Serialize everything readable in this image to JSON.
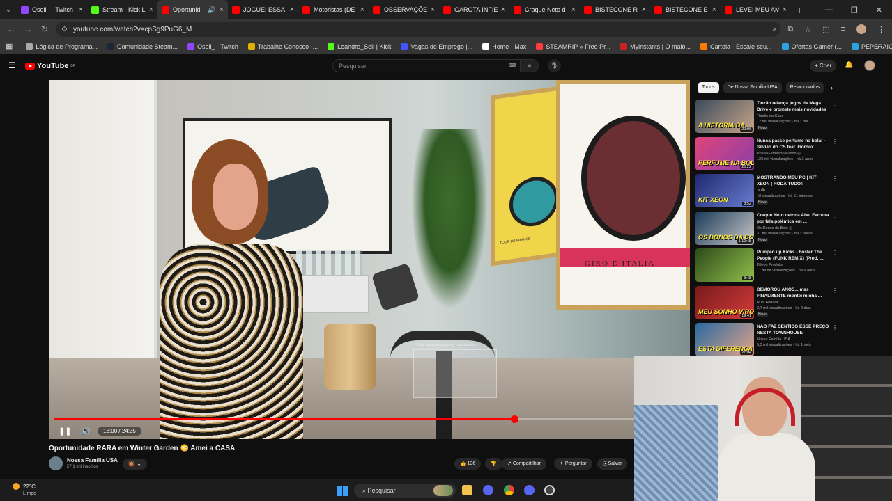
{
  "browser": {
    "tabs": [
      {
        "title": "Osell_ - Twitch",
        "color": "#9146ff",
        "active": false
      },
      {
        "title": "Stream - Kick L",
        "color": "#53fc18",
        "active": false
      },
      {
        "title": "Oportunid",
        "color": "#ff0000",
        "active": true
      },
      {
        "title": "JOGUEI ESSA P",
        "color": "#ff0000",
        "active": false
      },
      {
        "title": "Motoristas (DE",
        "color": "#ff0000",
        "active": false
      },
      {
        "title": "OBSERVAÇÕES",
        "color": "#ff0000",
        "active": false
      },
      {
        "title": "GAROTA INFIEL",
        "color": "#ff0000",
        "active": false
      },
      {
        "title": "Craque Neto d",
        "color": "#ff0000",
        "active": false
      },
      {
        "title": "BISTECONE RE",
        "color": "#ff0000",
        "active": false
      },
      {
        "title": "BISTECONE E C",
        "color": "#ff0000",
        "active": false
      },
      {
        "title": "LEVEI MEU AM",
        "color": "#ff0000",
        "active": false
      }
    ],
    "url": "youtube.com/watch?v=cpSg9PuG6_M",
    "bookmarks": [
      {
        "label": "Lógica de Programa...",
        "color": "#aaaaaa"
      },
      {
        "label": "Comunidade Steam...",
        "color": "#1b2838"
      },
      {
        "label": "Osell_ - Twitch",
        "color": "#9146ff"
      },
      {
        "label": "Trabalhe Conosco -...",
        "color": "#e0b000"
      },
      {
        "label": "Leandro_Sell | Kick",
        "color": "#53fc18"
      },
      {
        "label": "Vagas de Emprego |...",
        "color": "#4455ff"
      },
      {
        "label": "Home - Max",
        "color": "#ffffff"
      },
      {
        "label": "STEAMRIP » Free Pr...",
        "color": "#ff3b3b"
      },
      {
        "label": "Myinstants | O maio...",
        "color": "#cc2222"
      },
      {
        "label": "Cartola - Escale seu...",
        "color": "#ff7a00"
      },
      {
        "label": "Ofertas Gamer (...",
        "color": "#2aa3e0"
      },
      {
        "label": "PEPERAIO HARDWA...",
        "color": "#2aa3e0"
      }
    ]
  },
  "youtube": {
    "logo": "YouTube",
    "logo_region": "BR",
    "search_placeholder": "Pesquisar",
    "create_label": "Criar",
    "video": {
      "title": "Oportunidade RARA em Winter Garden 😳 Amei a CASA",
      "current_time": "18:00",
      "duration": "24:35",
      "time_display": "18:00 / 24:35",
      "progress_fraction": 0.73,
      "painting_label": "GIRO D'ITALIA",
      "poster_label": "TOUR DE FRANCE",
      "preview_text": "Puxe para cima para ver mais detalhes"
    },
    "channel": {
      "name": "Nossa Família USA",
      "subscribers": "57,1 mil inscritos"
    },
    "actions": {
      "likes": "136",
      "share": "Compartilhar",
      "ask": "Perguntar",
      "save": "Salvar"
    },
    "chips": [
      "Todos",
      "De Nossa Família USA",
      "Relacionados"
    ],
    "recommendations": [
      {
        "title": "Tiozão relança jogos de Mega Drive e promete mais novidades",
        "channel": "Tiozão da Casa",
        "views": "12 mil visualizações · há 1 dia",
        "badge": "Novo",
        "duration": "20:06",
        "thumb_text": "A HISTÓRIA DA",
        "thumb_a": "#3a4b5c",
        "thumb_b": "#c9a58a"
      },
      {
        "title": "Nunca passe perfume na bola! - Silvião do CS feat. Gordox",
        "channel": "PosseGamesBoMundo ◎",
        "views": "123 mil visualizações · há 2 anos",
        "badge": "",
        "duration": "20:22",
        "thumb_text": "PERFUME NA BOLA",
        "thumb_a": "#e0447a",
        "thumb_b": "#8a3fa8"
      },
      {
        "title": "MOSTRANDO MEU PC | KIT XEON | RODA TUDO!!",
        "channel": "JOÃO",
        "views": "10 visualizações · há 51 minutos",
        "badge": "Novo",
        "duration": "8:52",
        "thumb_text": "KIT XEON",
        "thumb_a": "#1e2a6e",
        "thumb_b": "#6a7bd1"
      },
      {
        "title": "Craque Neto detona Abel Ferreira por fala polêmica em ...",
        "channel": "Os Donos da Bola ◎",
        "views": "31 mil visualizações · há 3 horas",
        "badge": "Novo",
        "duration": "1:12:48",
        "thumb_text": "OS DONOS DA BOLA",
        "thumb_a": "#1b3b5a",
        "thumb_b": "#c8c8c8"
      },
      {
        "title": "Pumped up Kicks - Foster The People (FUNK REMIX) [Prod. ...",
        "channel": "Dileon Produtor",
        "views": "11 mi de visualizações · há 9 anos",
        "badge": "",
        "duration": "3:48",
        "thumb_text": "",
        "thumb_a": "#2d4a1a",
        "thumb_b": "#8fbf4a"
      },
      {
        "title": "DEMOROU ANOS... mas FINALMENTE montei minha ...",
        "channel": "Ruel Andarai",
        "views": "2,7 mil visualizações · há 2 dias",
        "badge": "Novo",
        "duration": "19:41",
        "thumb_text": "MEU SONHO VIROU REALIDADE",
        "thumb_a": "#7a1a1a",
        "thumb_b": "#d13b3b"
      },
      {
        "title": "NÃO FAZ SENTIDO ESSE PREÇO NESTA TOWNHOUSE",
        "channel": "Nossa Família USA",
        "views": "5,3 mil visualizações · há 1 mês",
        "badge": "",
        "duration": "21:04",
        "thumb_text": "ESTA DIFERENÇA",
        "thumb_a": "#2b6aa0",
        "thumb_b": "#e2a48a"
      }
    ]
  },
  "taskbar": {
    "temperature": "22°C",
    "weather": "Limpo",
    "search": "Pesquisar"
  }
}
